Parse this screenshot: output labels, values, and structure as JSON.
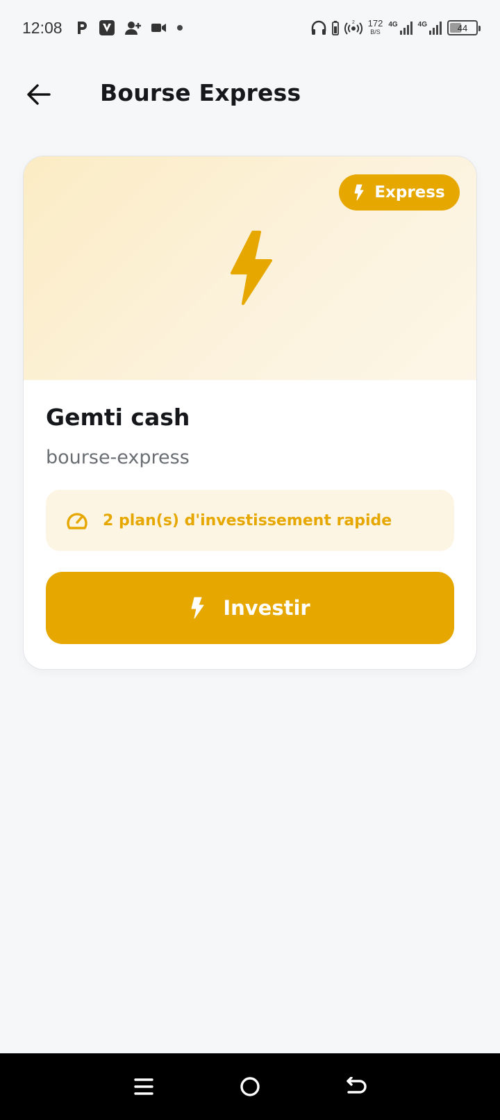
{
  "status_bar": {
    "time": "12:08",
    "net_speed_value": "172",
    "net_speed_unit": "B/S",
    "signal1_label": "4G",
    "signal2_label": "4G",
    "battery_level": "44",
    "icons": [
      "p-icon",
      "v-icon",
      "add-user-icon",
      "video-icon",
      "dot-icon",
      "headphones-icon",
      "battery-saver-icon",
      "hotspot-icon",
      "signal-icon",
      "battery-icon"
    ]
  },
  "header": {
    "title": "Bourse Express"
  },
  "card": {
    "badge_label": "Express",
    "name": "Gemti cash",
    "slug": "bourse-express",
    "info_text": "2 plan(s) d'investissement rapide",
    "button_label": "Investir"
  },
  "colors": {
    "accent": "#e6a800",
    "banner": "#fbecc4",
    "info_bg": "#fdf5e4",
    "background": "#f6f7f9"
  }
}
